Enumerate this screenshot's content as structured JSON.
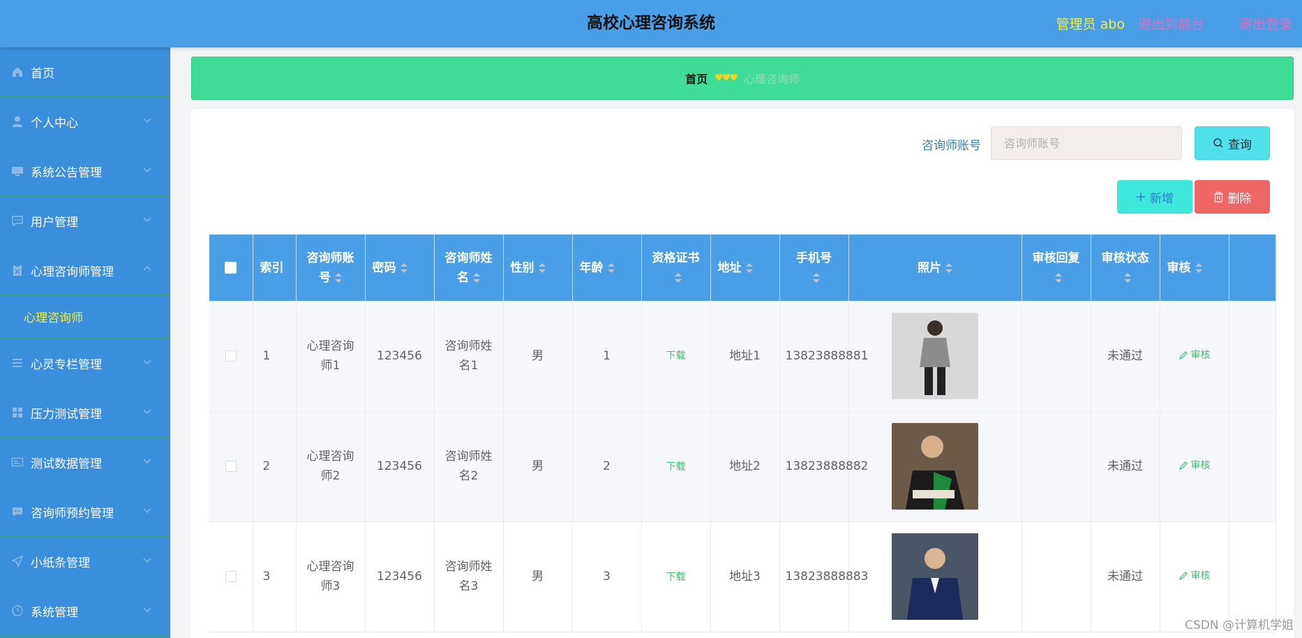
{
  "header": {
    "title": "高校心理咨询系统",
    "admin_label": "管理员 abo",
    "to_front_label": "退出到前台",
    "logout_label": "退出登录"
  },
  "sidebar": {
    "items": [
      {
        "label": "首页",
        "icon": "home-icon"
      },
      {
        "label": "个人中心",
        "icon": "user-icon"
      },
      {
        "label": "系统公告管理",
        "icon": "monitor-icon"
      },
      {
        "label": "用户管理",
        "icon": "chat-icon"
      },
      {
        "label": "心理咨询师管理",
        "icon": "clipboard-icon",
        "expanded": true
      },
      {
        "label": "心灵专栏管理",
        "icon": "list-icon"
      },
      {
        "label": "压力测试管理",
        "icon": "grid-icon"
      },
      {
        "label": "测试数据管理",
        "icon": "card-icon"
      },
      {
        "label": "咨询师预约管理",
        "icon": "message-icon"
      },
      {
        "label": "小纸条管理",
        "icon": "send-icon"
      },
      {
        "label": "系统管理",
        "icon": "clock-icon"
      }
    ],
    "submenu": {
      "label": "心理咨询师"
    }
  },
  "breadcrumb": {
    "home": "首页",
    "separator": "♥♥♥",
    "current": "心理咨询师"
  },
  "search": {
    "label": "咨询师账号",
    "placeholder": "咨询师账号",
    "value": "",
    "query_label": "查询"
  },
  "actions": {
    "add_label": "新增",
    "delete_label": "删除"
  },
  "table": {
    "columns": [
      "索引",
      "咨询师账号",
      "密码",
      "咨询师姓名",
      "性别",
      "年龄",
      "资格证书",
      "地址",
      "手机号",
      "照片",
      "审核回复",
      "审核状态",
      "审核"
    ],
    "rows": [
      {
        "index": "1",
        "account": "心理咨询师1",
        "password": "123456",
        "name": "咨询师姓名1",
        "gender": "男",
        "age": "1",
        "cert": "下载",
        "address": "地址1",
        "phone": "13823888881",
        "reply": "",
        "status": "未通过",
        "audit": "审核"
      },
      {
        "index": "2",
        "account": "心理咨询师2",
        "password": "123456",
        "name": "咨询师姓名2",
        "gender": "男",
        "age": "2",
        "cert": "下载",
        "address": "地址2",
        "phone": "13823888882",
        "reply": "",
        "status": "未通过",
        "audit": "审核"
      },
      {
        "index": "3",
        "account": "心理咨询师3",
        "password": "123456",
        "name": "咨询师姓名3",
        "gender": "男",
        "age": "3",
        "cert": "下载",
        "address": "地址3",
        "phone": "13823888883",
        "reply": "",
        "status": "未通过",
        "audit": "审核"
      }
    ]
  },
  "watermark": "CSDN @计算机学姐",
  "colors": {
    "header_bg": "#4a9ee5",
    "sidebar_bg": "#3a8edb",
    "breadcrumb_bg": "#3edc96",
    "accent_yellow": "#f5ee3a",
    "accent_pink": "#e56cc1",
    "query_btn": "#4fe0ea",
    "add_btn": "#3de8da",
    "delete_btn": "#ee6666",
    "link_green": "#3fbf6f"
  }
}
